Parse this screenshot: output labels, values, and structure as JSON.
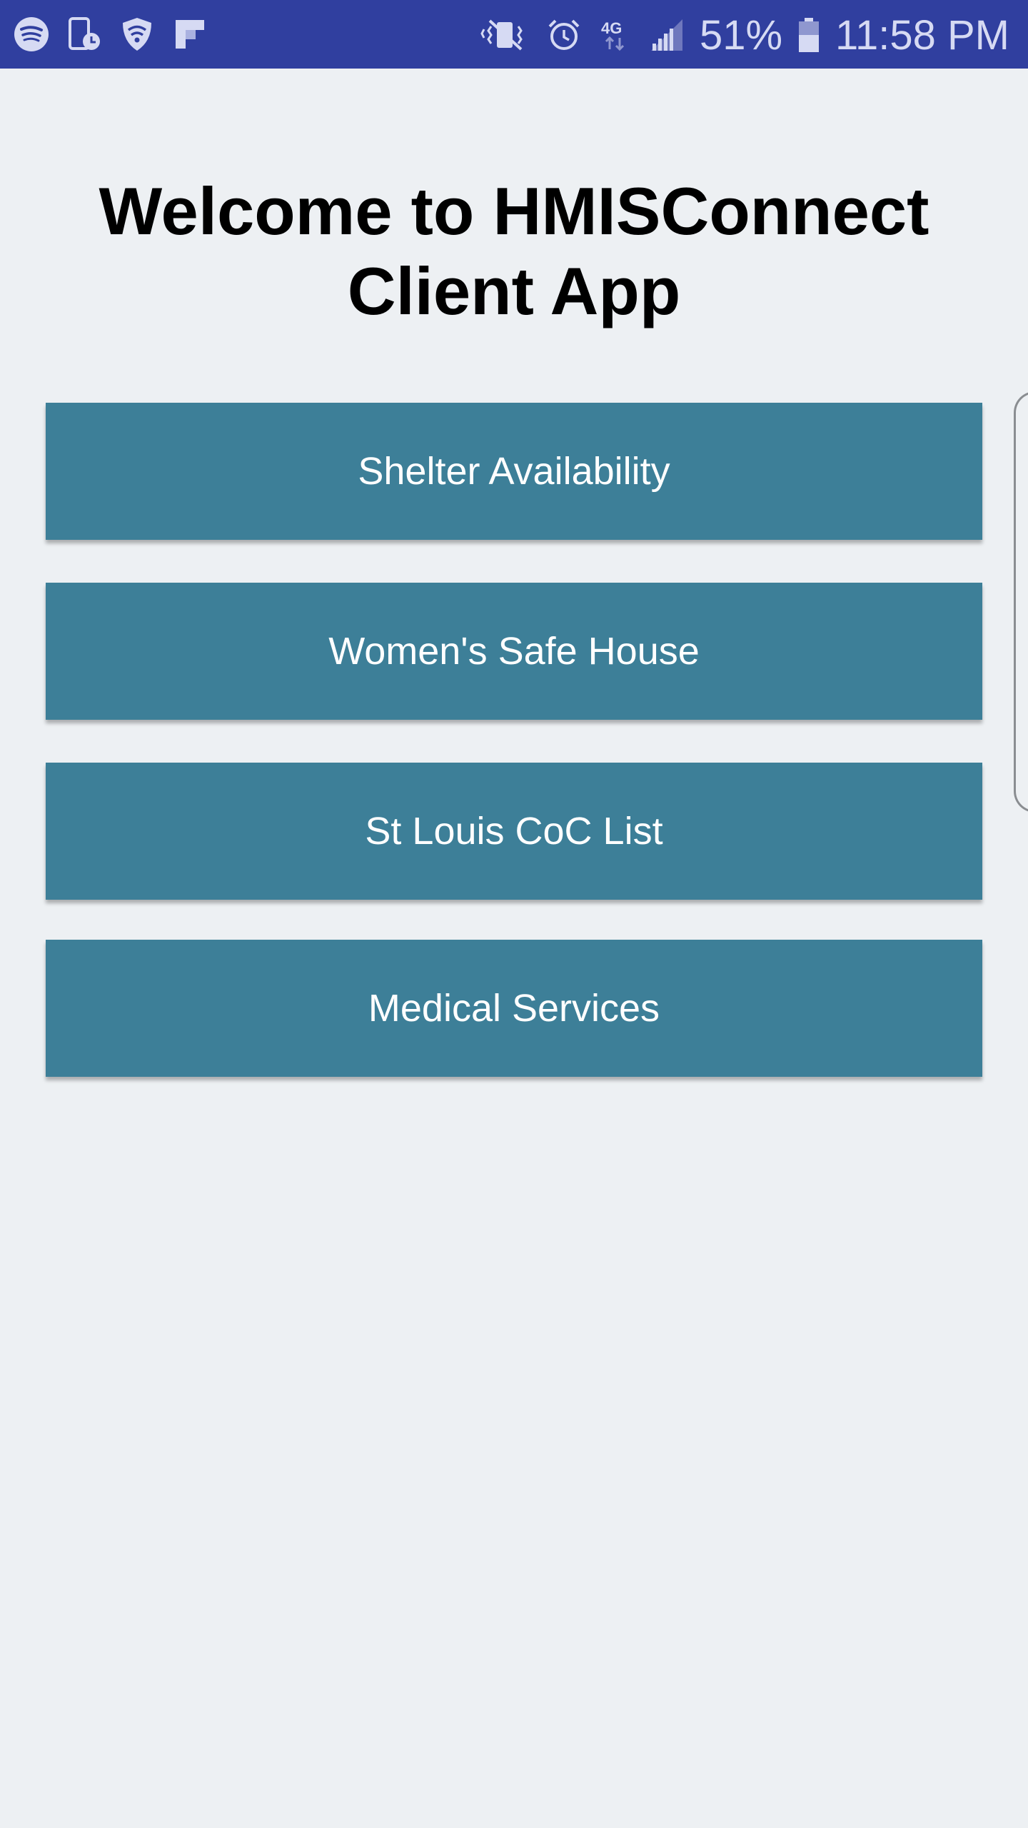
{
  "status_bar": {
    "color": "#303f9f",
    "left_icons": [
      "spotify-icon",
      "device-schedule-icon",
      "shield-wifi-icon",
      "flipboard-icon"
    ],
    "right_icons": [
      "vibrate-mute-icon",
      "alarm-icon",
      "4g-icon",
      "signal-icon"
    ],
    "battery_text": "51%",
    "time": "11:58 PM"
  },
  "page": {
    "title": "Welcome to HMISConnect Client App",
    "background": "#edf0f3"
  },
  "menu": {
    "button_color": "#3d7f98",
    "buttons": [
      {
        "label": "Shelter Availability"
      },
      {
        "label": "Women's Safe House"
      },
      {
        "label": "St Louis CoC List"
      },
      {
        "label": "Medical Services"
      }
    ]
  }
}
